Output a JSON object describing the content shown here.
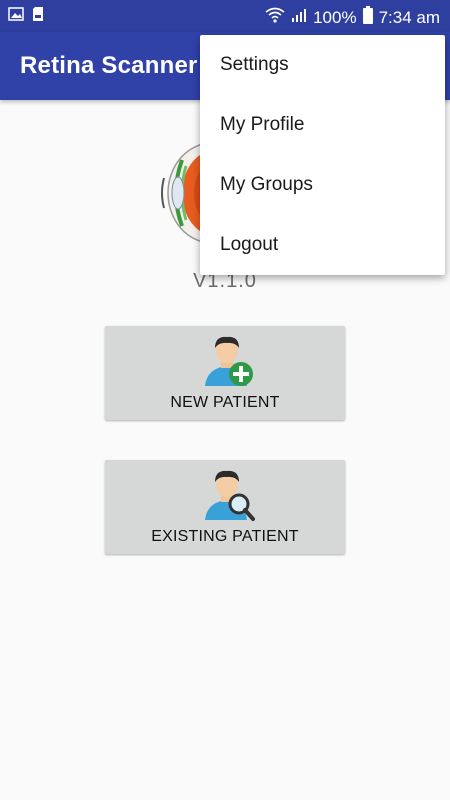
{
  "status_bar": {
    "battery": "100%",
    "time": "7:34 am",
    "icons": [
      "image-notification-icon",
      "sd-card-icon",
      "wifi-icon",
      "signal-icon",
      "battery-icon"
    ]
  },
  "app_bar": {
    "title": "Retina Scanner",
    "color": "#3041a8"
  },
  "main": {
    "version": "V1.1.0",
    "buttons": [
      {
        "label": "NEW PATIENT",
        "icon": "add-patient-icon"
      },
      {
        "label": "EXISTING PATIENT",
        "icon": "search-patient-icon"
      }
    ]
  },
  "menu": {
    "items": [
      {
        "label": "Settings"
      },
      {
        "label": "My Profile"
      },
      {
        "label": "My Groups"
      },
      {
        "label": "Logout"
      }
    ]
  }
}
